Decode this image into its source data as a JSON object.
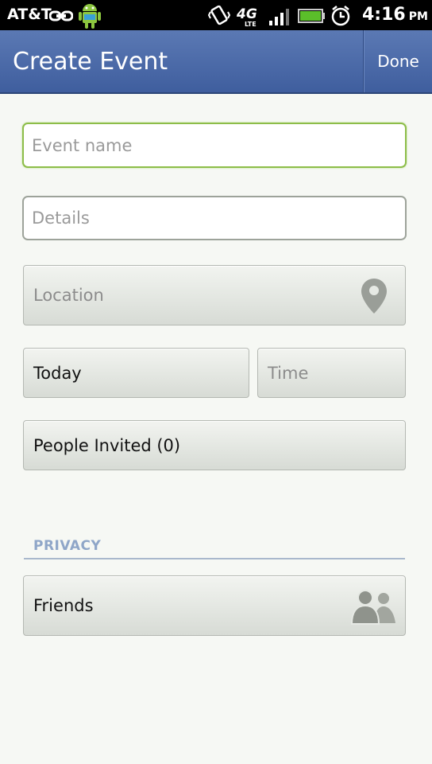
{
  "status_bar": {
    "carrier": "AT&T",
    "time": "4:16",
    "ampm": "PM",
    "network": "4G",
    "network_sub": "LTE",
    "icons": [
      "link-icon",
      "android-icon",
      "vibrate-icon",
      "4g-lte-icon",
      "signal-icon",
      "battery-icon",
      "alarm-icon"
    ]
  },
  "action_bar": {
    "title": "Create Event",
    "done_label": "Done",
    "color": "#4a69a8"
  },
  "form": {
    "event_name_placeholder": "Event name",
    "details_placeholder": "Details",
    "location_label": "Location",
    "date_label": "Today",
    "time_label": "Time",
    "people_invited_label": "People Invited (0)",
    "privacy_header": "PRIVACY",
    "privacy_value": "Friends",
    "focus_color": "#8dbd49"
  }
}
